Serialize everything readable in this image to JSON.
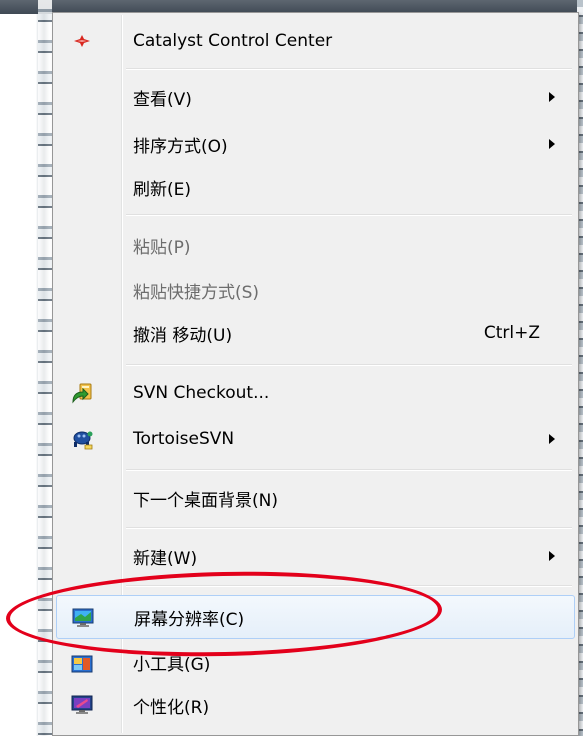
{
  "menu": {
    "items": [
      {
        "label": "Catalyst Control Center",
        "icon": "catalyst-icon",
        "submenu": false,
        "disabled": false
      },
      {
        "label": "查看(V)",
        "submenu": true,
        "disabled": false
      },
      {
        "label": "排序方式(O)",
        "submenu": true,
        "disabled": false
      },
      {
        "label": "刷新(E)",
        "submenu": false,
        "disabled": false
      },
      {
        "label": "粘贴(P)",
        "submenu": false,
        "disabled": true
      },
      {
        "label": "粘贴快捷方式(S)",
        "submenu": false,
        "disabled": true
      },
      {
        "label": "撤消 移动(U)",
        "shortcut": "Ctrl+Z",
        "submenu": false,
        "disabled": false
      },
      {
        "label": "SVN Checkout...",
        "icon": "svn-checkout-icon",
        "submenu": false,
        "disabled": false
      },
      {
        "label": "TortoiseSVN",
        "icon": "tortoisesvn-icon",
        "submenu": true,
        "disabled": false
      },
      {
        "label": "下一个桌面背景(N)",
        "submenu": false,
        "disabled": false
      },
      {
        "label": "新建(W)",
        "submenu": true,
        "disabled": false
      },
      {
        "label": "屏幕分辨率(C)",
        "icon": "screen-resolution-icon",
        "submenu": false,
        "disabled": false,
        "hovered": true
      },
      {
        "label": "小工具(G)",
        "icon": "gadgets-icon",
        "submenu": false,
        "disabled": false
      },
      {
        "label": "个性化(R)",
        "icon": "personalize-icon",
        "submenu": false,
        "disabled": false
      }
    ]
  },
  "colors": {
    "menu_bg": "#f0f0f0",
    "hover_bg": "#e5eff9",
    "hover_border": "#aecff7",
    "disabled_text": "#6d6d6d",
    "annotation": "#e3001b"
  }
}
